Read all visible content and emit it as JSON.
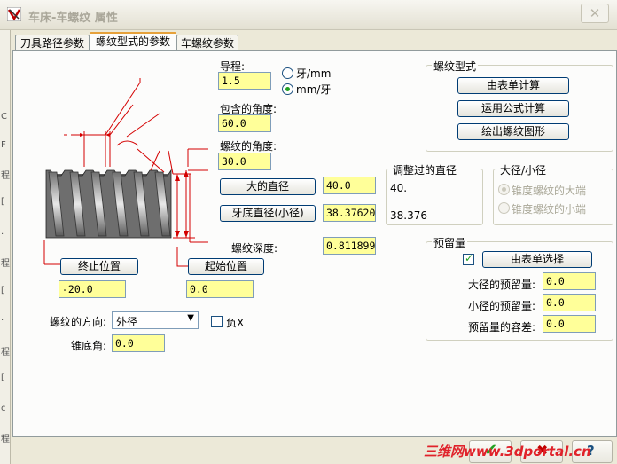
{
  "window": {
    "title": "车床-车螺纹 属性"
  },
  "leftstrip": [
    "C",
    "F",
    "程",
    "[",
    "·",
    "程",
    "[",
    "·",
    "程",
    "[",
    "c",
    "程"
  ],
  "tabs": [
    "刀具路径参数",
    "螺纹型式的参数",
    "车螺纹参数"
  ],
  "lead": {
    "label": "导程:",
    "value": "1.5"
  },
  "units": {
    "opt1": "牙/mm",
    "opt2": "mm/牙",
    "selected": "mm/牙"
  },
  "included_angle": {
    "label": "包含的角度:",
    "value": "60.0"
  },
  "thread_angle": {
    "label": "螺纹的角度:",
    "value": "30.0"
  },
  "major_diameter": {
    "button": "大的直径",
    "value": "40.0"
  },
  "minor_diameter": {
    "button": "牙底直径(小径)",
    "value": "38.376202"
  },
  "thread_depth": {
    "label": "螺纹深度:",
    "value": "0.811899"
  },
  "end_position": {
    "button": "终止位置",
    "value": "-20.0"
  },
  "start_position": {
    "button": "起始位置",
    "value": "0.0"
  },
  "thread_direction": {
    "label": "螺纹的方向:",
    "value": "外径"
  },
  "negative_x": {
    "label": "负X",
    "checked": false
  },
  "taper_angle": {
    "label": "锥底角:",
    "value": "0.0"
  },
  "thread_form": {
    "title": "螺纹型式",
    "btn_table": "由表单计算",
    "btn_formula": "运用公式计算",
    "btn_draw": "绘出螺纹图形"
  },
  "adjusted": {
    "title": "调整过的直径",
    "value1": "40.",
    "value2": "38.376"
  },
  "major_minor": {
    "title": "大径/小径",
    "opt1": "锥度螺纹的大端",
    "opt2": "锥度螺纹的小端"
  },
  "allowance": {
    "title": "预留量",
    "select_btn": "由表单选择",
    "checked": true,
    "major_label": "大径的预留量:",
    "major_value": "0.0",
    "minor_label": "小径的预留量:",
    "minor_value": "0.0",
    "tolerance_label": "预留量的容差:",
    "tolerance_value": "0.0"
  },
  "watermark": "三维网www.3dportal.cn",
  "colors": {
    "diagram": "#d40000",
    "field": "#ffff99",
    "accent": "#21a121"
  }
}
